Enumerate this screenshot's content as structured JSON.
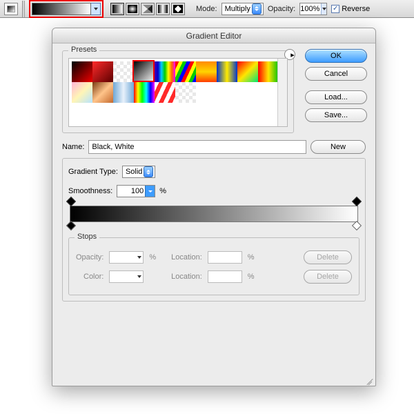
{
  "toolbar": {
    "mode_label": "Mode:",
    "mode_value": "Multiply",
    "opacity_label": "Opacity:",
    "opacity_value": "100%",
    "reverse_label": "Reverse",
    "reverse_checked": true,
    "gradient_types": [
      "linear",
      "radial",
      "angle",
      "reflected",
      "diamond"
    ]
  },
  "dialog": {
    "title": "Gradient Editor",
    "presets_label": "Presets",
    "buttons": {
      "ok": "OK",
      "cancel": "Cancel",
      "load": "Load...",
      "save": "Save...",
      "new": "New"
    },
    "name_label": "Name:",
    "name_value": "Black, White",
    "gradient_type_label": "Gradient Type:",
    "gradient_type_value": "Solid",
    "smoothness_label": "Smoothness:",
    "smoothness_value": "100",
    "smoothness_suffix": "%",
    "stops_label": "Stops",
    "stops": {
      "opacity_label": "Opacity:",
      "pct": "%",
      "location_label": "Location:",
      "color_label": "Color:",
      "delete_label": "Delete"
    },
    "presets": [
      {
        "name": "foreground-background",
        "css": "linear-gradient(135deg,#000,#e00)"
      },
      {
        "name": "red-orange",
        "css": "linear-gradient(135deg,#ff2a2a,#5c0000)"
      },
      {
        "name": "transparent",
        "css": "repeating-conic-gradient(#fff 0 25%,#e8e8e8 0 50%) 0 0/10px 10px"
      },
      {
        "name": "black-white",
        "css": "linear-gradient(135deg,#000,#fff)"
      },
      {
        "name": "spectrum-soft",
        "css": "linear-gradient(90deg,#4b00b0,#00c,#0cf,#0c0,#ff0,#f60,#f0f)"
      },
      {
        "name": "rainbow-stripes",
        "css": "repeating-linear-gradient(115deg,#f00 0 5px,#ff0 5px 10px,#0c0 10px 15px,#00f 15px 20px)"
      },
      {
        "name": "sunset",
        "css": "linear-gradient(180deg,#ff8a00,#ffd400,#ff3c00)"
      },
      {
        "name": "blue-yellow",
        "css": "linear-gradient(90deg,#0033cc,#ffeb00,#0033cc)"
      },
      {
        "name": "red-yellow-diag",
        "css": "linear-gradient(135deg,#ff0000,#ffe600,#00e676)"
      },
      {
        "name": "red-yellow-green",
        "css": "linear-gradient(90deg,#ff0000,#ffe600,#00c000)"
      },
      {
        "name": "pastel",
        "css": "linear-gradient(135deg,#ffb6d5,#fff5b6,#b6e3ff)"
      },
      {
        "name": "copper",
        "css": "linear-gradient(135deg,#7a3b12,#ffc48a,#c46a2e)"
      },
      {
        "name": "steel",
        "css": "linear-gradient(90deg,#6fa8d6,#e8f1fb,#6fa8d6)"
      },
      {
        "name": "rainbow",
        "css": "linear-gradient(90deg,#f00,#ff0,#0f0,#0ff,#00f,#f0f)"
      },
      {
        "name": "candy",
        "css": "repeating-linear-gradient(115deg,#fff 0 6px,#ff2a2a 6px 12px)"
      },
      {
        "name": "transparent2",
        "css": "repeating-conic-gradient(#fff 0 25%,#e8e8e8 0 50%) 0 0/10px 10px"
      }
    ],
    "highlighted_preset_index": 3
  },
  "chart_data": {
    "type": "bar",
    "note": "not a chart image"
  }
}
